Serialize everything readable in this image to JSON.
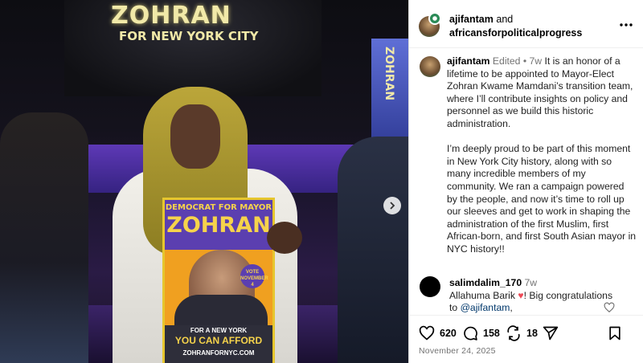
{
  "photo": {
    "banner_title": "ZOHRAN",
    "banner_sub": "FOR NEW YORK CITY",
    "side_banner": "ZOHRAN",
    "poster": {
      "headline": "DEMOCRAT FOR MAYOR",
      "name": "ZOHRAN",
      "vote": "VOTE NOVEMBER 4",
      "for_ny": "FOR A NEW YORK",
      "afford": "YOU CAN AFFORD",
      "url": "ZOHRANFORNYC.COM"
    },
    "next_icon": "chevron-right-icon"
  },
  "header": {
    "user1": "ajifantam",
    "conj": "and",
    "user2": "africansforpoliticalprogress",
    "more_icon": "more-icon"
  },
  "caption": {
    "username": "ajifantam",
    "edited": "Edited",
    "dot": "•",
    "age": "7w",
    "para1": "It is an honor of a lifetime to be appointed to Mayor-Elect Zohran Kwame Mamdani’s transition team, where I’ll contribute insights on policy and personnel as we build this historic administration.",
    "para2": "I’m deeply proud to be part of this moment in New York City history, along with so many incredible members of my community. We ran a campaign powered by the people, and now it’s time to roll up our sleeves and get to work in shaping the administration of the first Muslim, first African-born, and first South Asian mayor in NYC history!!"
  },
  "comment": {
    "username": "salimdalim_170",
    "age": "7w",
    "text_a": "Allahuma Barik",
    "heart": "♥",
    "text_b": "! Big congratulations to",
    "mention": "@ajifantam",
    "text_c": ","
  },
  "actions": {
    "likes": "620",
    "comments": "158",
    "reposts": "18",
    "date": "November 24, 2025"
  },
  "colors": {
    "accent_link": "#00376b",
    "meta_gray": "#737373",
    "heart_red": "#ed4956"
  }
}
